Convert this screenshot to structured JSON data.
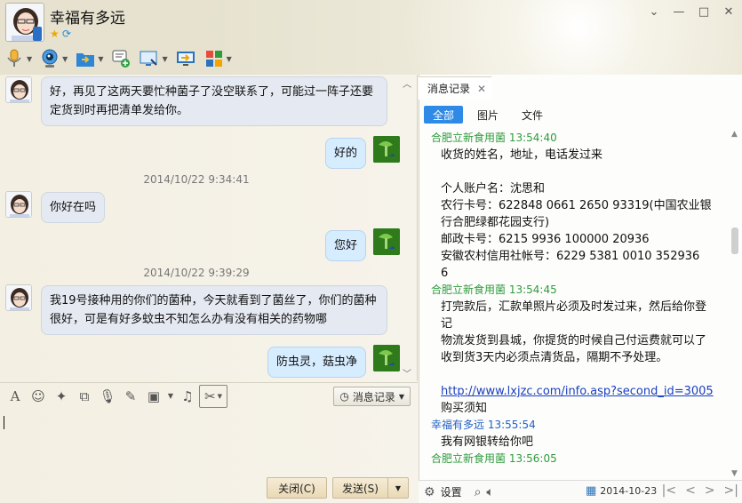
{
  "header": {
    "title": "幸福有多远",
    "window_buttons": [
      "⌄",
      "—",
      "□",
      "✕"
    ]
  },
  "chat": {
    "messages": [
      {
        "side": "left",
        "text_lines": [
          "好，再见了这两天要忙种菌子了没空联系了，可能过一阵子还要",
          "定货到时再把清单发给你。"
        ]
      },
      {
        "side": "right",
        "text": "好的"
      },
      {
        "side": "time",
        "text": "2014/10/22 9:34:41"
      },
      {
        "side": "left",
        "text": "你好在吗"
      },
      {
        "side": "right",
        "text": "您好"
      },
      {
        "side": "time",
        "text": "2014/10/22 9:39:29"
      },
      {
        "side": "left",
        "text_lines": [
          "我19号接种用的你们的菌种，今天就看到了菌丝了，你们的菌种",
          "很好，可是有好多蚊虫不知怎么办有没有相关的药物哪"
        ]
      },
      {
        "side": "right",
        "text": "防虫灵，菇虫净"
      }
    ]
  },
  "input": {
    "record_label": "消息记录",
    "close_label": "关闭(C)",
    "send_label": "发送(S)"
  },
  "history": {
    "tab_label": "消息记录",
    "filters": [
      "全部",
      "图片",
      "文件"
    ],
    "entries": [
      {
        "sender": "合肥立新食用菌",
        "time": "13:54:40",
        "me": false,
        "lines": [
          "收货的姓名，地址，电话发过来",
          "",
          "个人账户名：沈思和",
          "农行卡号：622848 0661 2650 93319(中国农业银",
          "行合肥绿都花园支行)",
          "邮政卡号：6215 9936 100000 20936",
          "安徽农村信用社帐号：6229  5381  0010  352936",
          "6"
        ]
      },
      {
        "sender": "合肥立新食用菌",
        "time": "13:54:45",
        "me": false,
        "lines": [
          "打完款后，汇款单照片必须及时发过来，然后给你登",
          "记",
          "物流发货到县城，你提货的时候自己付运费就可以了",
          "收到货3天内必须点清货品，隔期不予处理。",
          ""
        ],
        "link": "http://www.lxjzc.com/info.asp?second_id=3005",
        "after": "购买须知"
      },
      {
        "sender": "幸福有多远",
        "time": "13:55:54",
        "me": true,
        "lines": [
          "我有网银转给你吧"
        ]
      },
      {
        "sender": "合肥立新食用菌",
        "time": "13:56:05",
        "me": false,
        "lines": []
      }
    ],
    "footer_settings": "设置",
    "footer_date": "2014-10-23"
  },
  "colors": {
    "accent": "#2e8ae6",
    "sender_other": "#2f9b3c",
    "sender_me": "#2161c4"
  }
}
